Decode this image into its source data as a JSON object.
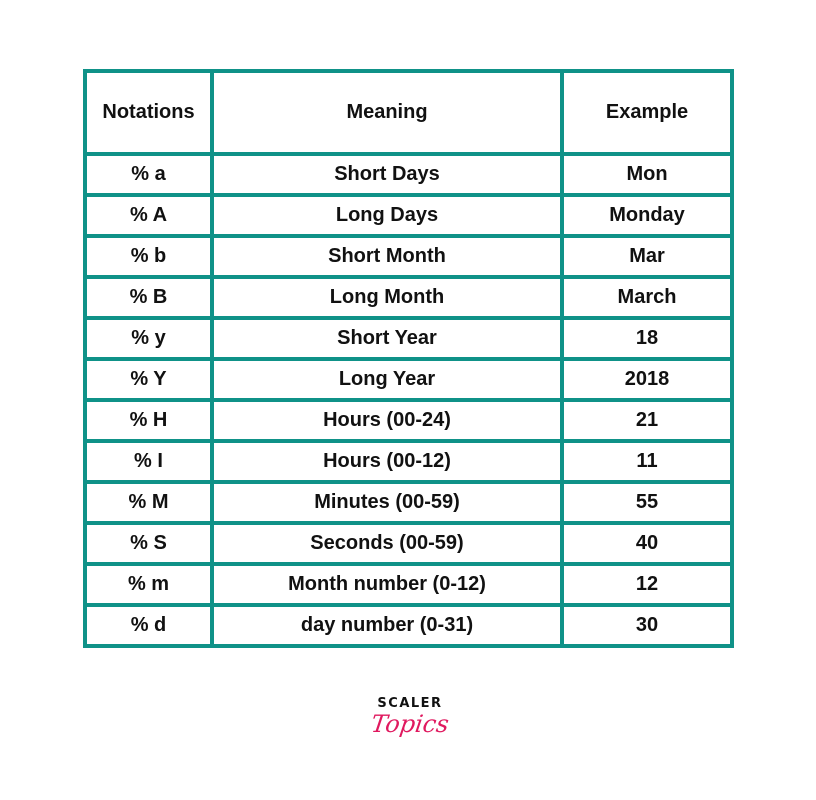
{
  "table": {
    "headers": [
      "Notations",
      "Meaning",
      "Example"
    ],
    "rows": [
      {
        "notation": "% a",
        "meaning": "Short Days",
        "example": "Mon"
      },
      {
        "notation": "% A",
        "meaning": "Long Days",
        "example": "Monday"
      },
      {
        "notation": "% b",
        "meaning": "Short Month",
        "example": "Mar"
      },
      {
        "notation": "% B",
        "meaning": "Long Month",
        "example": "March"
      },
      {
        "notation": "% y",
        "meaning": "Short Year",
        "example": "18"
      },
      {
        "notation": "% Y",
        "meaning": "Long Year",
        "example": "2018"
      },
      {
        "notation": "% H",
        "meaning": "Hours (00-24)",
        "example": "21"
      },
      {
        "notation": "% I",
        "meaning": "Hours (00-12)",
        "example": "11"
      },
      {
        "notation": "% M",
        "meaning": "Minutes (00-59)",
        "example": "55"
      },
      {
        "notation": "% S",
        "meaning": "Seconds (00-59)",
        "example": "40"
      },
      {
        "notation": "% m",
        "meaning": "Month number (0-12)",
        "example": "12"
      },
      {
        "notation": "% d",
        "meaning": "day number (0-31)",
        "example": "30"
      }
    ]
  },
  "logo": {
    "line1": "SCALER",
    "line2": "Topics"
  },
  "colors": {
    "border": "#0f9288",
    "logo_accent": "#e0195f",
    "text": "#111111"
  }
}
